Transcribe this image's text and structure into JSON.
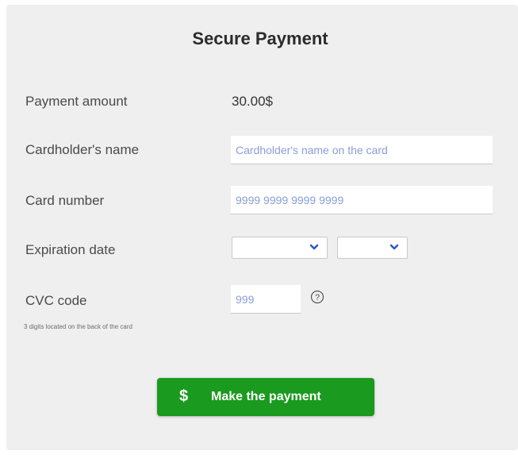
{
  "form": {
    "title": "Secure Payment",
    "amount_label": "Payment amount",
    "amount_value": "30.00$",
    "name_label": "Cardholder's name",
    "name_placeholder": "Cardholder's name on the card",
    "card_label": "Card number",
    "card_placeholder": "9999 9999 9999 9999",
    "expiry_label": "Expiration date",
    "expiry_month_value": "",
    "expiry_year_value": "",
    "cvc_label": "CVC code",
    "cvc_placeholder": "999",
    "cvc_help_icon": "question-circle-icon",
    "cvc_hint": "3 digits located on the back of the card"
  },
  "pay_button": {
    "icon": "dollar-icon",
    "icon_glyph": "$",
    "label": "Make the payment"
  },
  "colors": {
    "accent": "#1a9a1e",
    "chevron": "#2a55c8",
    "placeholder": "#8a9ed8",
    "panel_bg": "#efefef"
  }
}
